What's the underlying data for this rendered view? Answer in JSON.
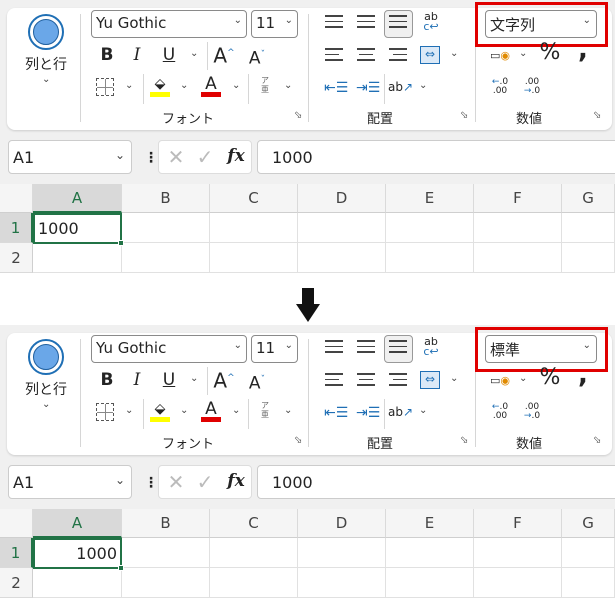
{
  "accent": "#217346",
  "highlight_color": "#e00000",
  "arrow_icon": "down-arrow-icon",
  "panels": [
    {
      "cells_label": "列と行",
      "font_name": "Yu Gothic",
      "font_size": "11",
      "font_group": "フォント",
      "align_group": "配置",
      "number_group": "数値",
      "number_format": "文字列",
      "name_box": "A1",
      "fx": "fx",
      "formula": "1000",
      "columns": [
        "A",
        "B",
        "C",
        "D",
        "E",
        "F",
        "G"
      ],
      "rows": [
        "1",
        "2"
      ],
      "a1": "1000",
      "a1_align": "left"
    },
    {
      "cells_label": "列と行",
      "font_name": "Yu Gothic",
      "font_size": "11",
      "font_group": "フォント",
      "align_group": "配置",
      "number_group": "数値",
      "number_format": "標準",
      "name_box": "A1",
      "fx": "fx",
      "formula": "1000",
      "columns": [
        "A",
        "B",
        "C",
        "D",
        "E",
        "F",
        "G"
      ],
      "rows": [
        "1",
        "2"
      ],
      "a1": "1000",
      "a1_align": "right"
    }
  ]
}
